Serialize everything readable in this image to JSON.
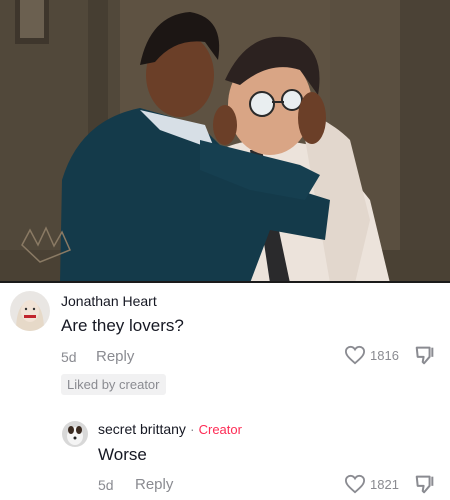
{
  "comments": [
    {
      "username": "Jonathan Heart",
      "text": "Are they lovers?",
      "age": "5d",
      "reply_label": "Reply",
      "likes": "1816",
      "liked_by_creator": "Liked by creator"
    }
  ],
  "reply": {
    "username": "secret brittany",
    "separator": "·",
    "creator_badge": "Creator",
    "text": "Worse",
    "age": "5d",
    "reply_label": "Reply",
    "likes": "1821"
  },
  "icons": {
    "like": "heart-icon",
    "dislike": "thumbs-down-icon"
  },
  "colors": {
    "creator": "#fe2c55",
    "muted": "#8a8b91",
    "text": "#161823"
  }
}
